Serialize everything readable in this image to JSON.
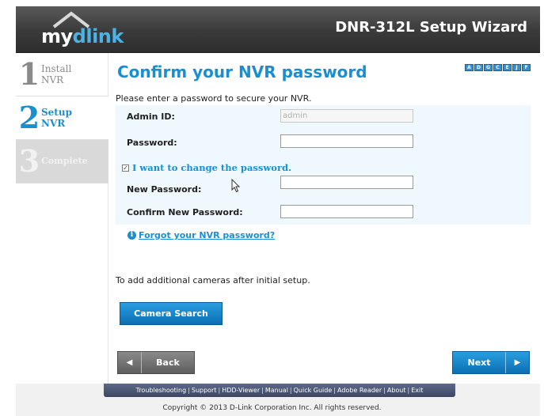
{
  "header": {
    "logo_my": "my",
    "logo_dlink": "dlink",
    "title": "DNR-312L Setup Wizard"
  },
  "sidebar": {
    "steps": [
      {
        "number": "1",
        "line1": "Install",
        "line2": "NVR",
        "state": "done"
      },
      {
        "number": "2",
        "line1": "Setup",
        "line2": "NVR",
        "state": "active"
      },
      {
        "number": "3",
        "line1": "Complete",
        "line2": "",
        "state": "pending"
      }
    ]
  },
  "main": {
    "title": "Confirm your NVR password",
    "language_icons": [
      "A",
      "D",
      "G",
      "C",
      "E",
      "J",
      "F"
    ],
    "intro": "Please enter a password to secure your NVR.",
    "admin_id_label": "Admin ID:",
    "admin_id_value": "admin",
    "password_label": "Password:",
    "password_value": "",
    "change_password_checked": true,
    "change_password_label": "I want to change the password.",
    "new_password_label": "New Password:",
    "new_password_value": "",
    "confirm_password_label": "Confirm New Password:",
    "confirm_password_value": "",
    "forgot_link": "Forgot your NVR password?",
    "additional_text": "To add additional cameras after initial setup.",
    "camera_search_label": "Camera Search",
    "back_label": "Back",
    "next_label": "Next"
  },
  "footer": {
    "links": [
      "Troubleshooting",
      "Support",
      "HDD-Viewer",
      "Manual",
      "Quick Guide",
      "Adobe Reader",
      "About",
      "Exit"
    ],
    "copyright": "Copyright © 2013 D-Link Corporation Inc. All rights reserved."
  },
  "colors": {
    "accent": "#1a8fd0",
    "header_bg": "#3a3a3a",
    "form_bg": "#eef8fd"
  }
}
